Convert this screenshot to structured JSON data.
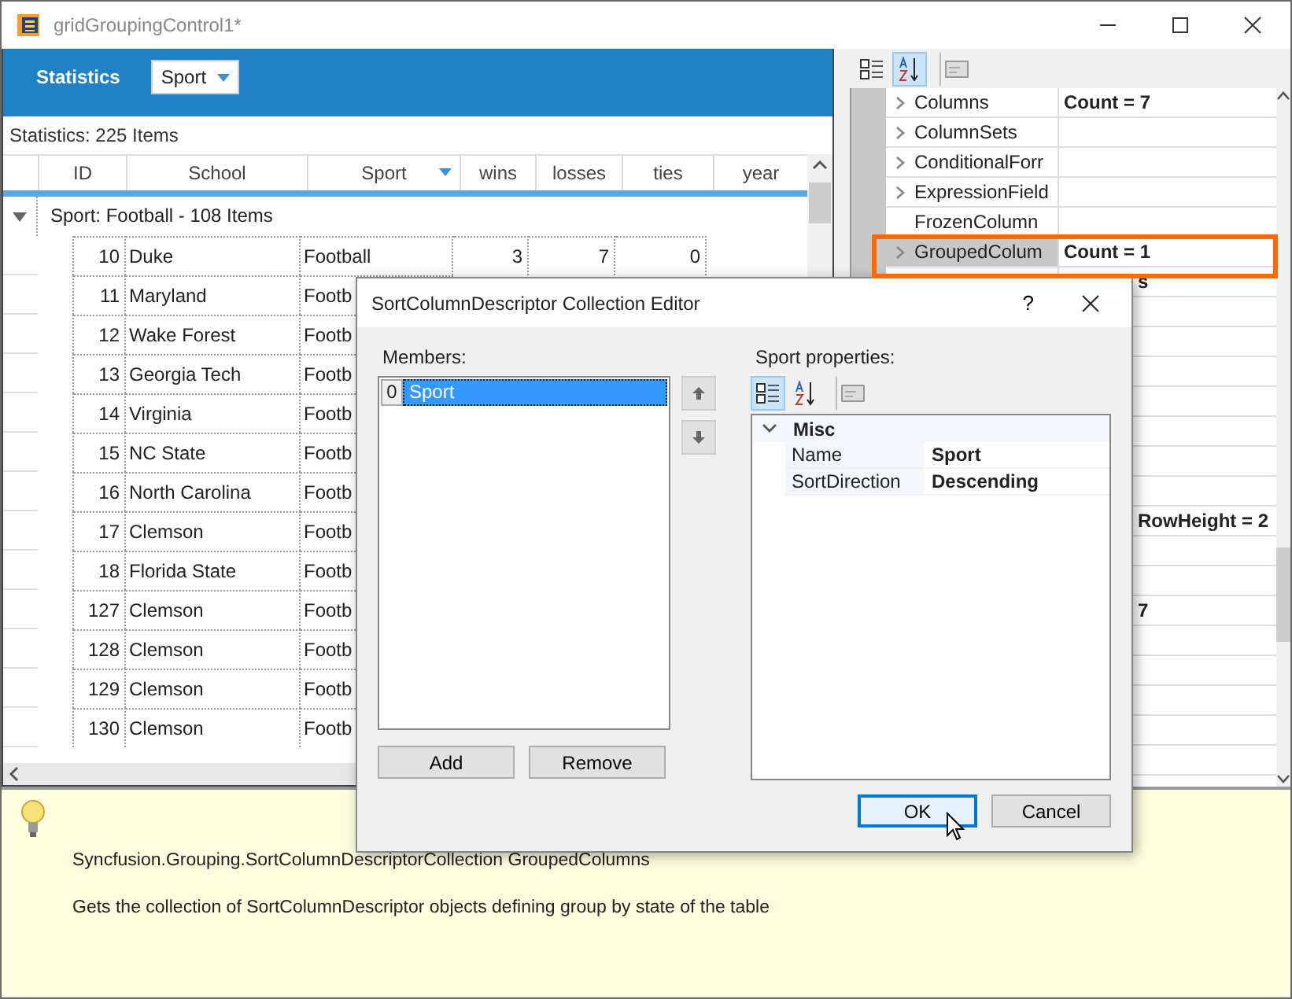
{
  "window": {
    "title": "gridGroupingControl1*"
  },
  "banner": {
    "title": "Statistics",
    "dropdown": "Sport"
  },
  "grid": {
    "caption": "Statistics: 225 Items",
    "columns": [
      {
        "label": "ID",
        "sorted": false
      },
      {
        "label": "School",
        "sorted": false
      },
      {
        "label": "Sport",
        "sorted": true
      },
      {
        "label": "wins",
        "sorted": false
      },
      {
        "label": "losses",
        "sorted": false
      },
      {
        "label": "ties",
        "sorted": false
      },
      {
        "label": "year",
        "sorted": false
      }
    ],
    "group": {
      "label": "Sport: Football - 108 Items",
      "expanded": true
    },
    "rows": [
      {
        "cells": [
          "10",
          "Duke",
          "Football",
          "3",
          "7",
          "0"
        ]
      },
      {
        "cells": [
          "11",
          "Maryland",
          "Footb"
        ]
      },
      {
        "cells": [
          "12",
          "Wake Forest",
          "Footb"
        ]
      },
      {
        "cells": [
          "13",
          "Georgia Tech",
          "Footb"
        ]
      },
      {
        "cells": [
          "14",
          "Virginia",
          "Footb"
        ]
      },
      {
        "cells": [
          "15",
          "NC State",
          "Footb"
        ]
      },
      {
        "cells": [
          "16",
          "North Carolina",
          "Footb"
        ]
      },
      {
        "cells": [
          "17",
          "Clemson",
          "Footb"
        ]
      },
      {
        "cells": [
          "18",
          "Florida State",
          "Footb"
        ]
      },
      {
        "cells": [
          "127",
          "Clemson",
          "Footb"
        ]
      },
      {
        "cells": [
          "128",
          "Clemson",
          "Footb"
        ]
      },
      {
        "cells": [
          "129",
          "Clemson",
          "Footb"
        ]
      },
      {
        "cells": [
          "130",
          "Clemson",
          "Footb"
        ]
      }
    ]
  },
  "property_grid": {
    "toolbar": [
      {
        "kind": "categorized",
        "selected": false
      },
      {
        "kind": "alphabetical",
        "selected": true
      },
      {
        "kind": "pages",
        "selected": false
      }
    ],
    "rows": [
      {
        "kind": "property",
        "name": "Columns",
        "value": "Count = 7",
        "expandable": true,
        "selected": false
      },
      {
        "kind": "property",
        "name": "ColumnSets",
        "expandable": true,
        "selected": false
      },
      {
        "kind": "property",
        "name": "ConditionalForr",
        "expandable": true,
        "selected": false
      },
      {
        "kind": "property",
        "name": "ExpressionField",
        "expandable": true,
        "selected": false
      },
      {
        "kind": "property",
        "name": "FrozenColumn",
        "expandable": false,
        "selected": false
      },
      {
        "kind": "property",
        "name": "GroupedColum",
        "value": "Count = 1",
        "expandable": true,
        "selected": true,
        "highlighted": true
      },
      {
        "kind": "covered",
        "value": "s"
      },
      {
        "kind": "covered"
      },
      {
        "kind": "covered"
      },
      {
        "kind": "covered"
      },
      {
        "kind": "covered"
      },
      {
        "kind": "covered"
      },
      {
        "kind": "covered"
      },
      {
        "kind": "covered"
      },
      {
        "kind": "covered",
        "value": "RowHeight = 2"
      },
      {
        "kind": "covered"
      },
      {
        "kind": "covered"
      },
      {
        "kind": "covered",
        "value": "7"
      },
      {
        "kind": "covered"
      },
      {
        "kind": "covered"
      },
      {
        "kind": "covered"
      },
      {
        "kind": "covered"
      },
      {
        "kind": "covered"
      }
    ]
  },
  "dialog": {
    "title": "SortColumnDescriptor Collection Editor",
    "help": "?",
    "members_label": "Members:",
    "members": [
      {
        "index": "0",
        "name": "Sport",
        "selected": true
      }
    ],
    "add": "Add",
    "remove": "Remove",
    "properties_label": "Sport properties:",
    "toolbar": [
      {
        "kind": "categorized",
        "selected": true
      },
      {
        "kind": "alphabetical",
        "selected": false
      },
      {
        "kind": "pages",
        "selected": false
      }
    ],
    "category": {
      "label": "Misc",
      "expanded": true
    },
    "properties": [
      {
        "name": "Name",
        "value": "Sport"
      },
      {
        "name": "SortDirection",
        "value": "Descending"
      }
    ],
    "ok": "OK",
    "cancel": "Cancel"
  },
  "help": {
    "title": "Syncfusion.Grouping.SortColumnDescriptorCollection GroupedColumns",
    "description": "Gets the collection of SortColumnDescriptor objects defining group by state of the table"
  }
}
